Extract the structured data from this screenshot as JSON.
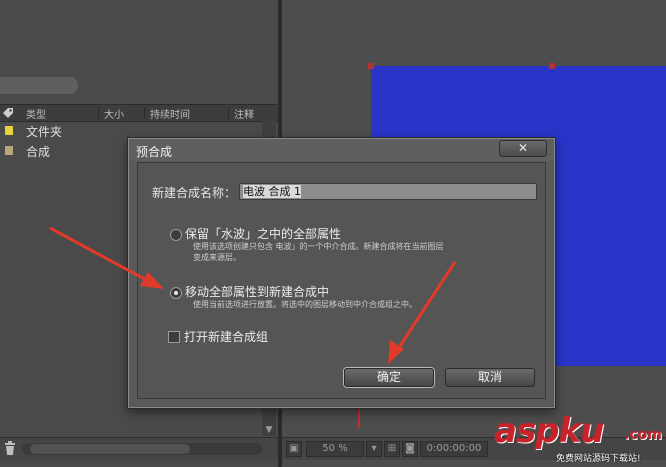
{
  "project_panel": {
    "columns": [
      "类型",
      "大小",
      "持续时间",
      "注释"
    ],
    "items": [
      {
        "name": "文件夹",
        "color": "#e8d23a"
      },
      {
        "name": "合成",
        "color": "#b8a57c"
      }
    ],
    "icons": {
      "label": "tag-icon",
      "flowchart": "flowchart-icon",
      "delete": "trash-icon"
    }
  },
  "viewer": {
    "zoom": "50 %",
    "timecode": "0:00:00:00",
    "layer_color": "#2835c8"
  },
  "dialog": {
    "title": "预合成",
    "close_label": "✕",
    "name_label": "新建合成名称：",
    "name_value": "电波 合成 1",
    "options": [
      {
        "label": "保留「水波」之中的全部属性",
        "description": "使用该选项创建只包含 电波」的一个中介合成。新建合成将在当前图层变成来源层。",
        "selected": false
      },
      {
        "label": "移动全部属性到新建合成中",
        "description": "使用当前选项进行放置。将选中的图层移动到中介合成组之中。",
        "selected": true
      }
    ],
    "open_new_comp_label": "打开新建合成组",
    "open_new_comp_checked": false,
    "ok_label": "确定",
    "cancel_label": "取消"
  },
  "watermark": {
    "brand": "aspku",
    "tld": ".com",
    "slogan": "免费网站源码下载站!"
  },
  "annotation_color": "#e03a2a"
}
